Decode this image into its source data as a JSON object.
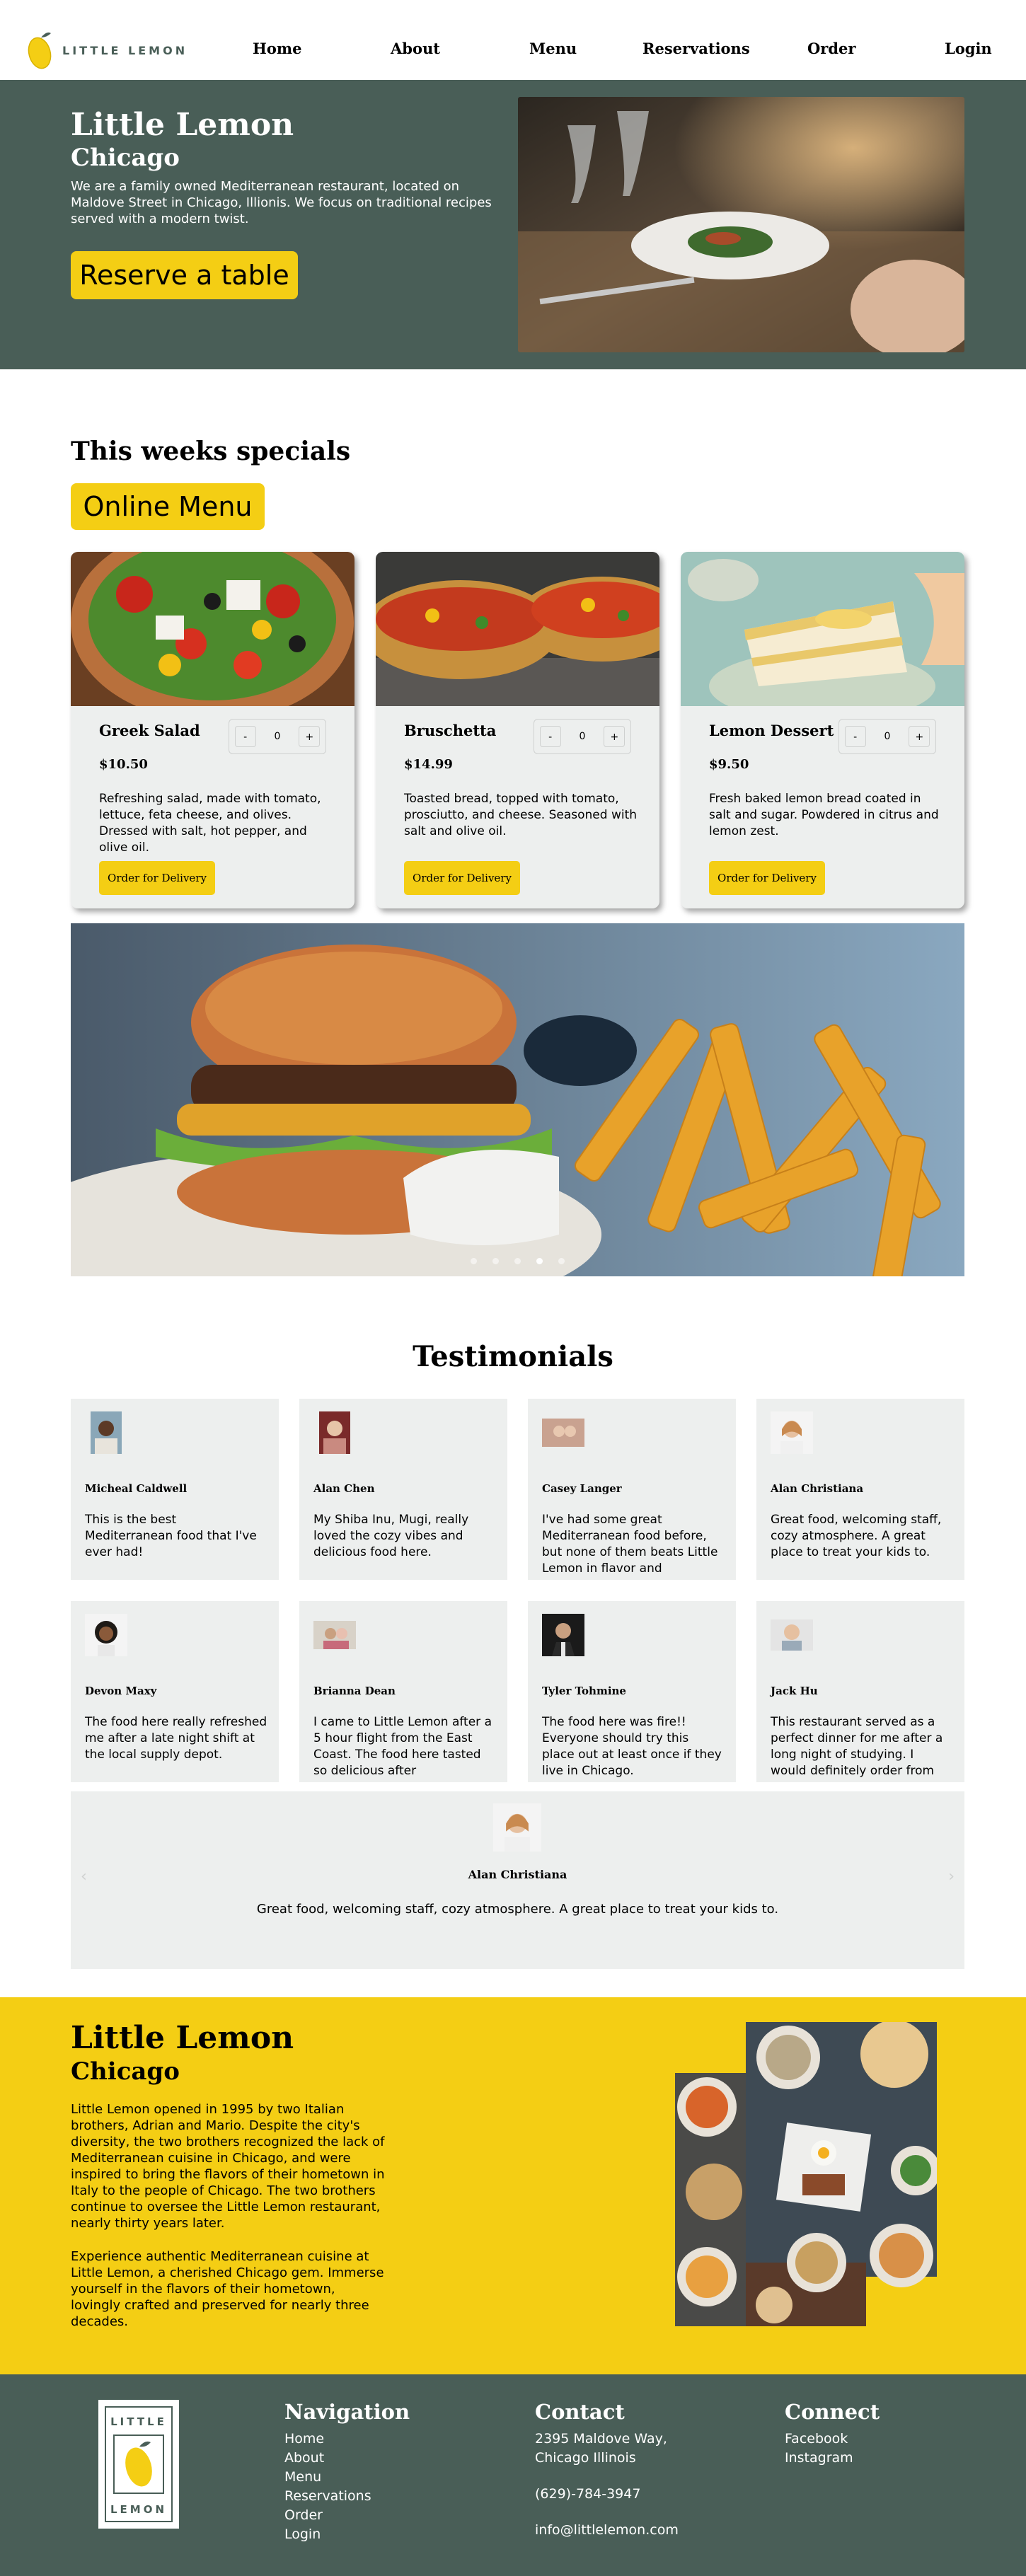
{
  "nav": {
    "logo_text": "LITTLE LEMON",
    "links": [
      "Home",
      "About",
      "Menu",
      "Reservations",
      "Order",
      "Login"
    ]
  },
  "hero": {
    "title": "Little Lemon",
    "subtitle": "Chicago",
    "description": "We are a family owned Mediterranean restaurant, located on Maldove Street in Chicago, Illionis. We focus on traditional recipes served with a modern twist.",
    "cta": "Reserve a table"
  },
  "specials": {
    "title": "This weeks specials",
    "menu_button": "Online Menu",
    "items": [
      {
        "name": "Greek Salad",
        "price": "$10.50",
        "qty": "0",
        "minus": "-",
        "plus": "+",
        "description": "Refreshing salad, made with tomato, lettuce, feta cheese, and olives. Dressed with salt, hot pepper, and olive oil.",
        "order": "Order for Delivery"
      },
      {
        "name": "Bruschetta",
        "price": "$14.99",
        "qty": "0",
        "minus": "-",
        "plus": "+",
        "description": "Toasted bread, topped with tomato, prosciutto, and cheese. Seasoned with salt and olive oil.",
        "order": "Order for Delivery"
      },
      {
        "name": "Lemon Dessert",
        "price": "$9.50",
        "qty": "0",
        "minus": "-",
        "plus": "+",
        "description": "Fresh baked lemon bread coated in salt and sugar. Powdered in citrus and lemon zest.",
        "order": "Order for Delivery"
      }
    ],
    "carousel_active_index": 3,
    "carousel_count": 5
  },
  "testimonials": {
    "title": "Testimonials",
    "items": [
      {
        "name": "Micheal Caldwell",
        "text": "This is the best Mediterranean food that I've ever had!"
      },
      {
        "name": "Alan Chen",
        "text": "My Shiba Inu, Mugi, really loved the cozy vibes and delicious food here."
      },
      {
        "name": "Casey Langer",
        "text": "I've had some great Mediterranean food before, but none of them beats Little Lemon in flavor and"
      },
      {
        "name": "Alan Christiana",
        "text": "Great food, welcoming staff, cozy atmosphere. A great place to treat your kids to."
      },
      {
        "name": "Devon Maxy",
        "text": "The food here really refreshed me after a late night shift at the local supply depot."
      },
      {
        "name": "Brianna Dean",
        "text": "I came to Little Lemon after a 5 hour flight from the East Coast. The food here tasted so delicious after"
      },
      {
        "name": "Tyler Tohmine",
        "text": "The food here was fire!! Everyone should try this place out at least once if they live in Chicago."
      },
      {
        "name": "Jack Hu",
        "text": "This restaurant served as a perfect dinner for me after a long night of studying. I would definitely order from"
      }
    ],
    "featured": {
      "name": "Alan Christiana",
      "text": "Great food, welcoming staff, cozy atmosphere. A great place to treat your kids to.",
      "prev": "‹",
      "next": "›"
    }
  },
  "about": {
    "title": "Little Lemon",
    "subtitle": "Chicago",
    "paragraph1": "Little Lemon opened in 1995 by two Italian brothers, Adrian and Mario. Despite the city's diversity, the two brothers recognized the lack of Mediterranean cuisine in Chicago, and were inspired to bring the flavors of their hometown in Italy to the people of Chicago. The two brothers continue to oversee the Little Lemon restaurant, nearly thirty years later.",
    "paragraph2": "Experience authentic Mediterranean cuisine at Little Lemon, a cherished Chicago gem. Immerse yourself in the flavors of their hometown, lovingly crafted and preserved for nearly three decades."
  },
  "footer": {
    "logo_top": "LITTLE",
    "logo_bottom": "LEMON",
    "navigation": {
      "title": "Navigation",
      "links": [
        "Home",
        "About",
        "Menu",
        "Reservations",
        "Order",
        "Login"
      ]
    },
    "contact": {
      "title": "Contact",
      "address1": "2395 Maldove Way,",
      "address2": "Chicago Illinois",
      "phone": "(629)-784-3947",
      "email": "info@littlelemon.com"
    },
    "connect": {
      "title": "Connect",
      "links": [
        "Facebook",
        "Instagram"
      ]
    }
  },
  "colors": {
    "primary": "#495e57",
    "accent": "#f4ce14",
    "card": "#edefee"
  }
}
